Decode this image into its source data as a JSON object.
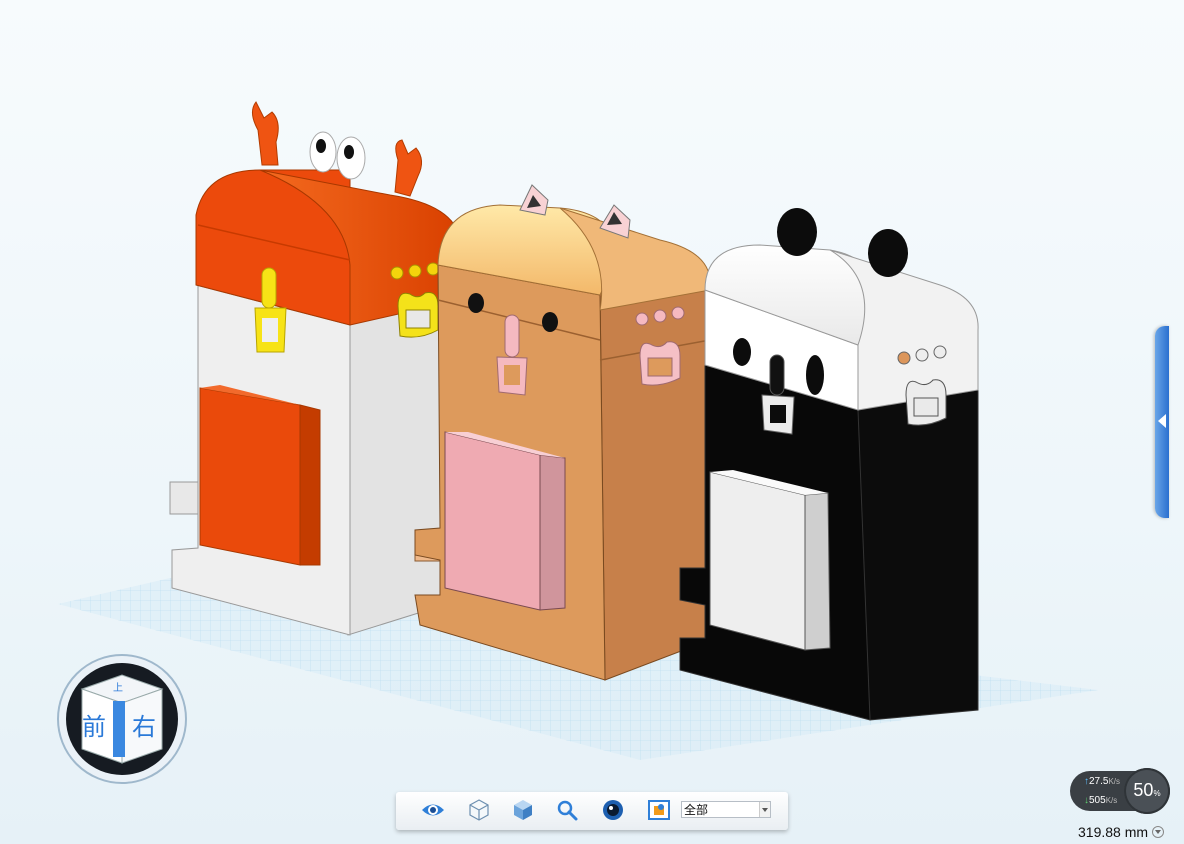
{
  "viewcube": {
    "front_label": "前",
    "right_label": "右",
    "top_label": "上"
  },
  "toolbar": {
    "buttons": [
      {
        "icon": "eye-icon"
      },
      {
        "icon": "wireframe-cube-icon"
      },
      {
        "icon": "shaded-cube-icon"
      },
      {
        "icon": "zoom-icon"
      },
      {
        "icon": "render-icon"
      },
      {
        "icon": "section-view-icon"
      }
    ],
    "filter_value": "全部"
  },
  "network": {
    "upload_value": "27.5",
    "download_value": "505",
    "unit": "K/s",
    "gauge_value": "50",
    "gauge_unit": "%"
  },
  "scale": {
    "value": "319.88 mm"
  },
  "colors": {
    "crab_orange": "#e8460b",
    "cat_tan": "#dc965b",
    "panda_black": "#0b0b0b",
    "grid_blue": "#bfe0f2",
    "accent_blue": "#2a6fcf"
  }
}
